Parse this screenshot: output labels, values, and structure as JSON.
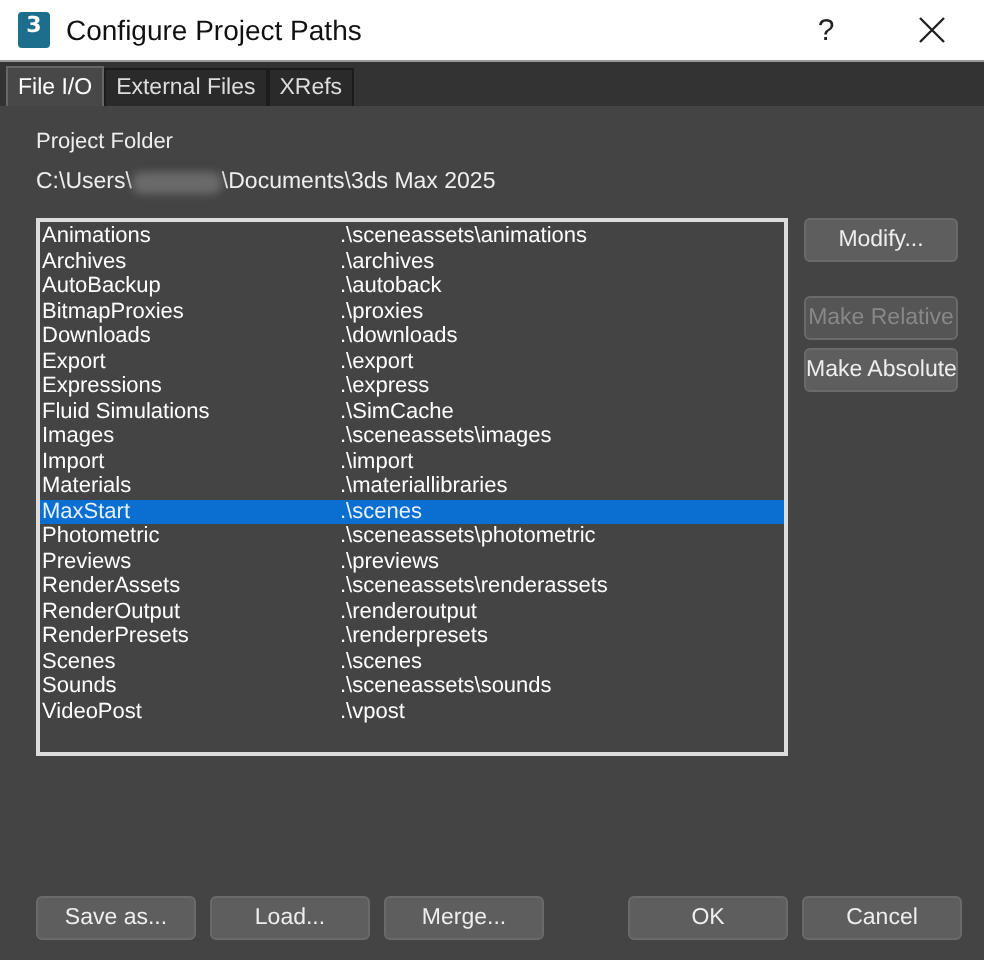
{
  "window": {
    "title": "Configure Project Paths",
    "app_icon": "3",
    "help": "?"
  },
  "tabs": [
    {
      "label": "File I/O",
      "selected": true
    },
    {
      "label": "External Files",
      "selected": false
    },
    {
      "label": "XRefs",
      "selected": false
    }
  ],
  "project_folder": {
    "label": "Project Folder",
    "path_start": "C:\\Users\\",
    "path_end": "\\Documents\\3ds Max 2025",
    "redacted": true
  },
  "paths": [
    {
      "name": "Animations",
      "path": ".\\sceneassets\\animations",
      "selected": false
    },
    {
      "name": "Archives",
      "path": ".\\archives",
      "selected": false
    },
    {
      "name": "AutoBackup",
      "path": ".\\autoback",
      "selected": false
    },
    {
      "name": "BitmapProxies",
      "path": ".\\proxies",
      "selected": false
    },
    {
      "name": "Downloads",
      "path": ".\\downloads",
      "selected": false
    },
    {
      "name": "Export",
      "path": ".\\export",
      "selected": false
    },
    {
      "name": "Expressions",
      "path": ".\\express",
      "selected": false
    },
    {
      "name": "Fluid Simulations",
      "path": ".\\SimCache",
      "selected": false
    },
    {
      "name": "Images",
      "path": ".\\sceneassets\\images",
      "selected": false
    },
    {
      "name": "Import",
      "path": ".\\import",
      "selected": false
    },
    {
      "name": "Materials",
      "path": ".\\materiallibraries",
      "selected": false
    },
    {
      "name": "MaxStart",
      "path": ".\\scenes",
      "selected": true
    },
    {
      "name": "Photometric",
      "path": ".\\sceneassets\\photometric",
      "selected": false
    },
    {
      "name": "Previews",
      "path": ".\\previews",
      "selected": false
    },
    {
      "name": "RenderAssets",
      "path": ".\\sceneassets\\renderassets",
      "selected": false
    },
    {
      "name": "RenderOutput",
      "path": ".\\renderoutput",
      "selected": false
    },
    {
      "name": "RenderPresets",
      "path": ".\\renderpresets",
      "selected": false
    },
    {
      "name": "Scenes",
      "path": ".\\scenes",
      "selected": false
    },
    {
      "name": "Sounds",
      "path": ".\\sceneassets\\sounds",
      "selected": false
    },
    {
      "name": "VideoPost",
      "path": ".\\vpost",
      "selected": false
    }
  ],
  "side_buttons": [
    {
      "label": "Modify...",
      "disabled": false
    },
    {
      "label": "Make Relative",
      "disabled": true
    },
    {
      "label": "Make Absolute",
      "disabled": false
    }
  ],
  "left_buttons": [
    "Save as...",
    "Load...",
    "Merge..."
  ],
  "right_buttons": [
    "OK",
    "Cancel"
  ]
}
